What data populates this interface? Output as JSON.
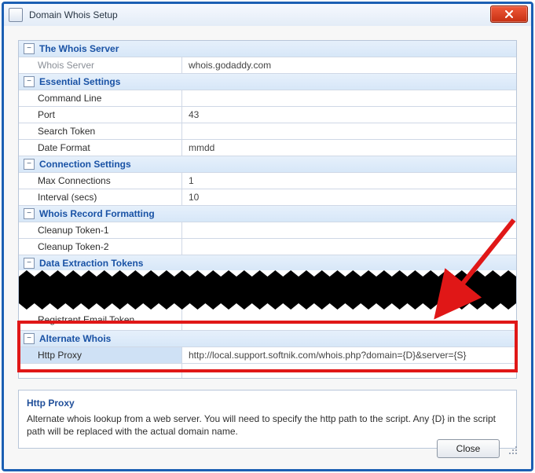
{
  "window": {
    "title": "Domain Whois Setup",
    "close_button_icon": "close-icon"
  },
  "grid": {
    "sections": {
      "whois_server": {
        "title": "The Whois Server",
        "rows": {
          "server": {
            "label": "Whois Server",
            "value": "whois.godaddy.com"
          }
        }
      },
      "essential": {
        "title": "Essential Settings",
        "rows": {
          "command_line": {
            "label": "Command Line",
            "value": ""
          },
          "port": {
            "label": "Port",
            "value": "43"
          },
          "search_token": {
            "label": "Search Token",
            "value": ""
          },
          "date_format": {
            "label": "Date Format",
            "value": "mmdd"
          }
        }
      },
      "connection": {
        "title": "Connection Settings",
        "rows": {
          "max_conn": {
            "label": "Max Connections",
            "value": "1"
          },
          "interval": {
            "label": "Interval (secs)",
            "value": "10"
          }
        }
      },
      "formatting": {
        "title": "Whois Record Formatting",
        "rows": {
          "cleanup1": {
            "label": "Cleanup Token-1",
            "value": ""
          },
          "cleanup2": {
            "label": "Cleanup Token-2",
            "value": ""
          }
        }
      },
      "extraction": {
        "title": "Data Extraction Tokens",
        "rows": {
          "reg_email": {
            "label": "Registrant Email Token",
            "value": ""
          }
        }
      },
      "alternate": {
        "title": "Alternate Whois",
        "rows": {
          "http_proxy": {
            "label": "Http Proxy",
            "value": "http://local.support.softnik.com/whois.php?domain={D}&server={S}"
          }
        }
      }
    }
  },
  "hint": {
    "title": "Http Proxy",
    "body": "Alternate whois lookup from a web server. You will need to specify the http path to the script. Any {D} in the script path will be replaced with the actual domain name."
  },
  "buttons": {
    "close": "Close"
  },
  "annotation": {
    "type": "arrow",
    "color": "#e01717",
    "points_to": "alternate-whois-section"
  }
}
